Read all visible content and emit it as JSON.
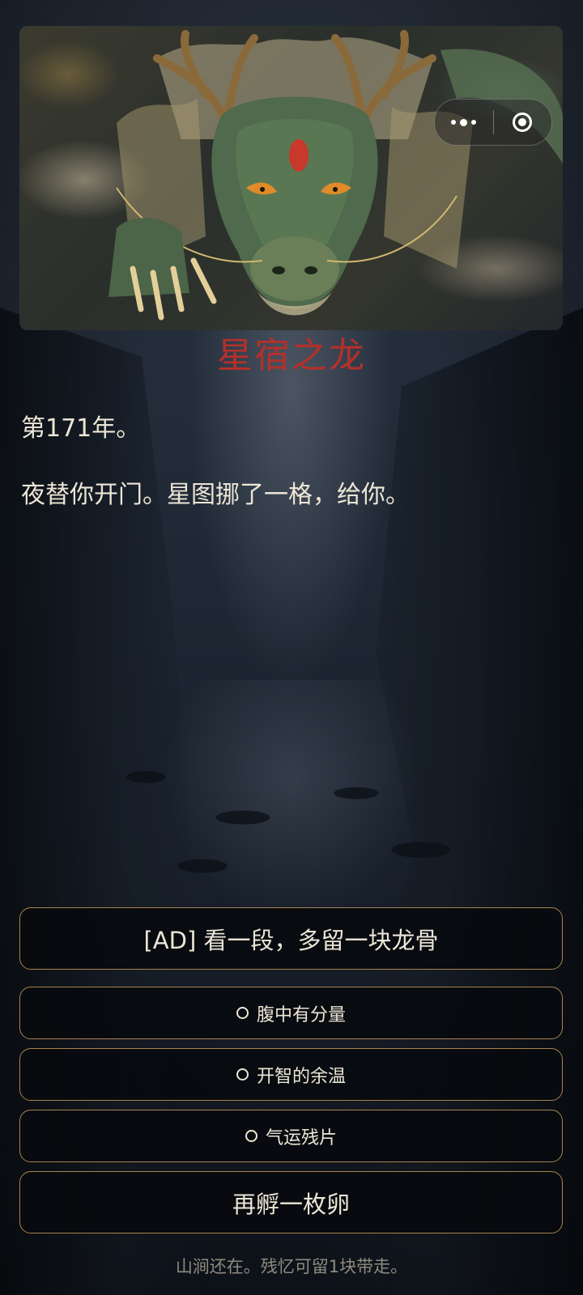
{
  "header": {
    "title": "星宿之龙",
    "menu_icon": "more-dots-icon",
    "close_icon": "close-circle-icon"
  },
  "story": {
    "year_line": "第171年。",
    "event_line": "夜替你开门。星图挪了一格，给你。"
  },
  "actions": {
    "ad_button": "[AD] 看一段，多留一块龙骨",
    "options": [
      {
        "label": "腹中有分量",
        "selected": false
      },
      {
        "label": "开智的余温",
        "selected": false
      },
      {
        "label": "气运残片",
        "selected": false
      }
    ],
    "hatch_button": "再孵一枚卵"
  },
  "footer": {
    "status": "山涧还在。残忆可留1块带走。"
  },
  "colors": {
    "title": "#b4302a",
    "button_border": "#a8834f",
    "button_bg": "#080a0e",
    "text": "#ece6d6",
    "footer_text": "#8f8a80"
  }
}
